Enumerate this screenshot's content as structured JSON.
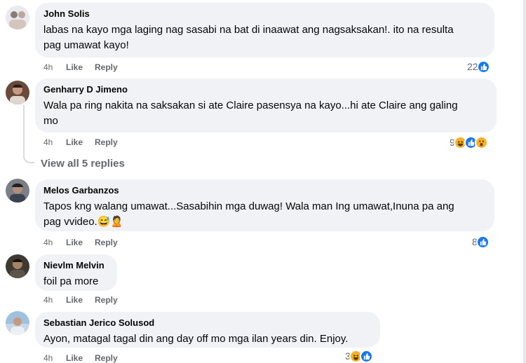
{
  "comments": [
    {
      "author": "John Solis",
      "text": "labas na kayo mga laging nag sasabi na bat di inaawat ang nagsaksakan!. ito na resulta\npag umawat kayo!",
      "time": "4h",
      "like_label": "Like",
      "reply_label": "Reply",
      "reaction_count": "22",
      "reactions": [
        "like-icon"
      ]
    },
    {
      "author": "Genharry D Jimeno",
      "text": "Wala pa ring nakita na saksakan si ate Claire pasensya na kayo...hi ate Claire ang galing\nmo",
      "time": "4h",
      "like_label": "Like",
      "reply_label": "Reply",
      "reaction_count": "9",
      "reactions": [
        "haha-icon",
        "like-icon",
        "wow-icon"
      ],
      "view_replies": "View all 5 replies"
    },
    {
      "author": "Melos Garbanzos",
      "text": "Tapos kng walang umawat...Sasabihin mga duwag! Wala man Ing umawat,Inuna pa ang\npag vvideo.😅🙎",
      "time": "4h",
      "like_label": "Like",
      "reply_label": "Reply",
      "reaction_count": "8",
      "reactions": [
        "like-icon"
      ]
    },
    {
      "author": "Nievlm Melvin",
      "text": "foil pa more",
      "time": "4h",
      "like_label": "Like",
      "reply_label": "Reply"
    },
    {
      "author": "Sebastian Jerico Solusod",
      "text": "Ayon, matagal tagal din ang day off mo mga ilan years din. Enjoy.",
      "time": "4h",
      "like_label": "Like",
      "reply_label": "Reply",
      "reaction_count": "3",
      "reactions": [
        "haha-icon",
        "like-icon"
      ]
    }
  ],
  "colors": {
    "bubble": "#f0f2f5",
    "secondary_text": "#65676b",
    "like_blue": "#1877f2",
    "emoji_yellow": "#f7b125"
  }
}
